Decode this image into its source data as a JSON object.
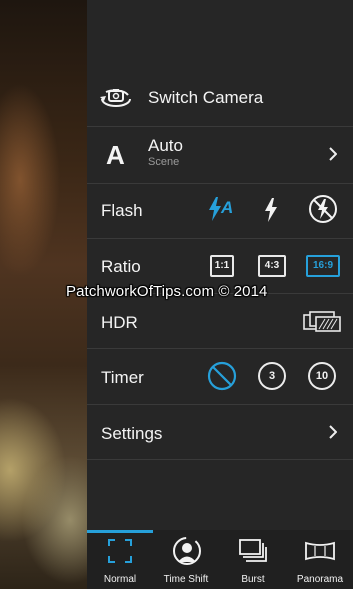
{
  "menu": {
    "switch_camera": "Switch Camera",
    "scene_value": "Auto",
    "scene_label": "Scene",
    "flash_label": "Flash",
    "ratio_label": "Ratio",
    "ratio_options": [
      "1:1",
      "4:3",
      "16:9"
    ],
    "ratio_selected": "16:9",
    "hdr_label": "HDR",
    "timer_label": "Timer",
    "timer_options": [
      "3",
      "10"
    ],
    "settings_label": "Settings",
    "scene_icon_letter": "A",
    "flash_auto_letter": "A"
  },
  "tabs": [
    {
      "label": "Normal",
      "active": true
    },
    {
      "label": "Time Shift",
      "active": false
    },
    {
      "label": "Burst",
      "active": false
    },
    {
      "label": "Panorama",
      "active": false
    }
  ],
  "watermark": "PatchworkOfTips.com © 2014",
  "colors": {
    "accent": "#26a0da",
    "drawer": "#262626",
    "text": "#f2f2f2"
  }
}
